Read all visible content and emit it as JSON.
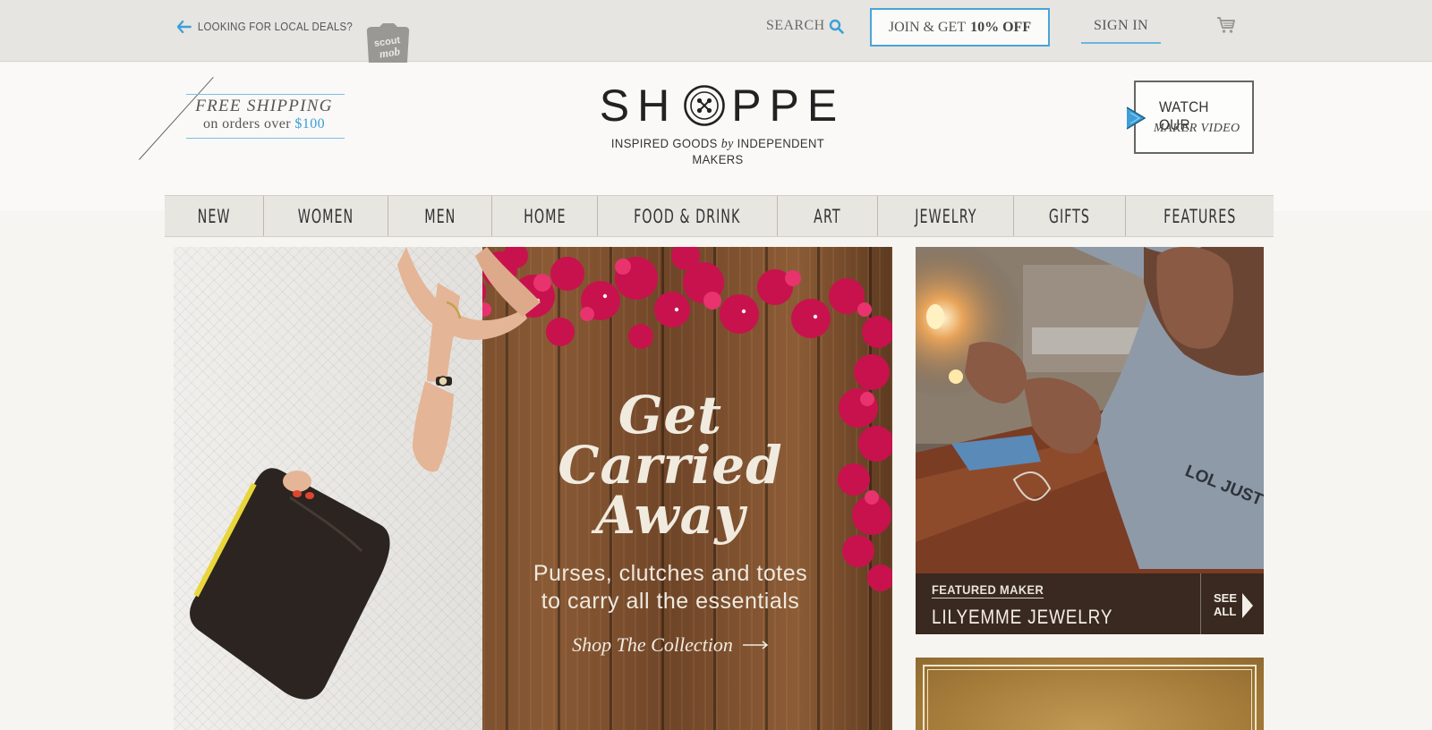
{
  "utility": {
    "local_deals": "LOOKING FOR LOCAL DEALS?",
    "scoutmob_logo_text": "scout mob",
    "search_label": "SEARCH",
    "join_prefix": "JOIN & GET",
    "join_bold": "10% OFF",
    "sign_in": "SIGN IN"
  },
  "header": {
    "free_shipping_line1": "FREE SHIPPING",
    "free_shipping_line2": "on orders over",
    "free_shipping_amount": "$100",
    "logo_left": "SH",
    "logo_right": "PPE",
    "tagline_left": "INSPIRED GOODS",
    "tagline_by": "by",
    "tagline_right": "INDEPENDENT MAKERS",
    "watch_line1": "WATCH OUR",
    "watch_line2": "MAKER VIDEO"
  },
  "nav": {
    "items": [
      {
        "label": "NEW"
      },
      {
        "label": "WOMEN"
      },
      {
        "label": "MEN"
      },
      {
        "label": "HOME"
      },
      {
        "label": "FOOD & DRINK"
      },
      {
        "label": "ART"
      },
      {
        "label": "JEWELRY"
      },
      {
        "label": "GIFTS"
      },
      {
        "label": "FEATURES"
      }
    ]
  },
  "hero": {
    "title": "Get\nCarried\nAway",
    "subtitle": "Purses, clutches and totes\nto carry all the essentials",
    "cta": "Shop The Collection"
  },
  "featured_maker": {
    "kicker": "FEATURED MAKER",
    "name": "LILYEMME JEWELRY",
    "see_all": "SEE\nALL",
    "shirt_text": "LOL JUST KITTEN"
  },
  "colors": {
    "accent_blue": "#4aa4d6",
    "flower_pink": "#d01550",
    "wood_brown": "#7a4e2e"
  },
  "icons": {
    "back": "arrow-left-icon",
    "search": "search-icon",
    "cart": "cart-icon",
    "logo_o": "button-icon",
    "play": "play-icon",
    "cta": "arrow-right-icon",
    "see_all": "chevron-right-icon"
  }
}
